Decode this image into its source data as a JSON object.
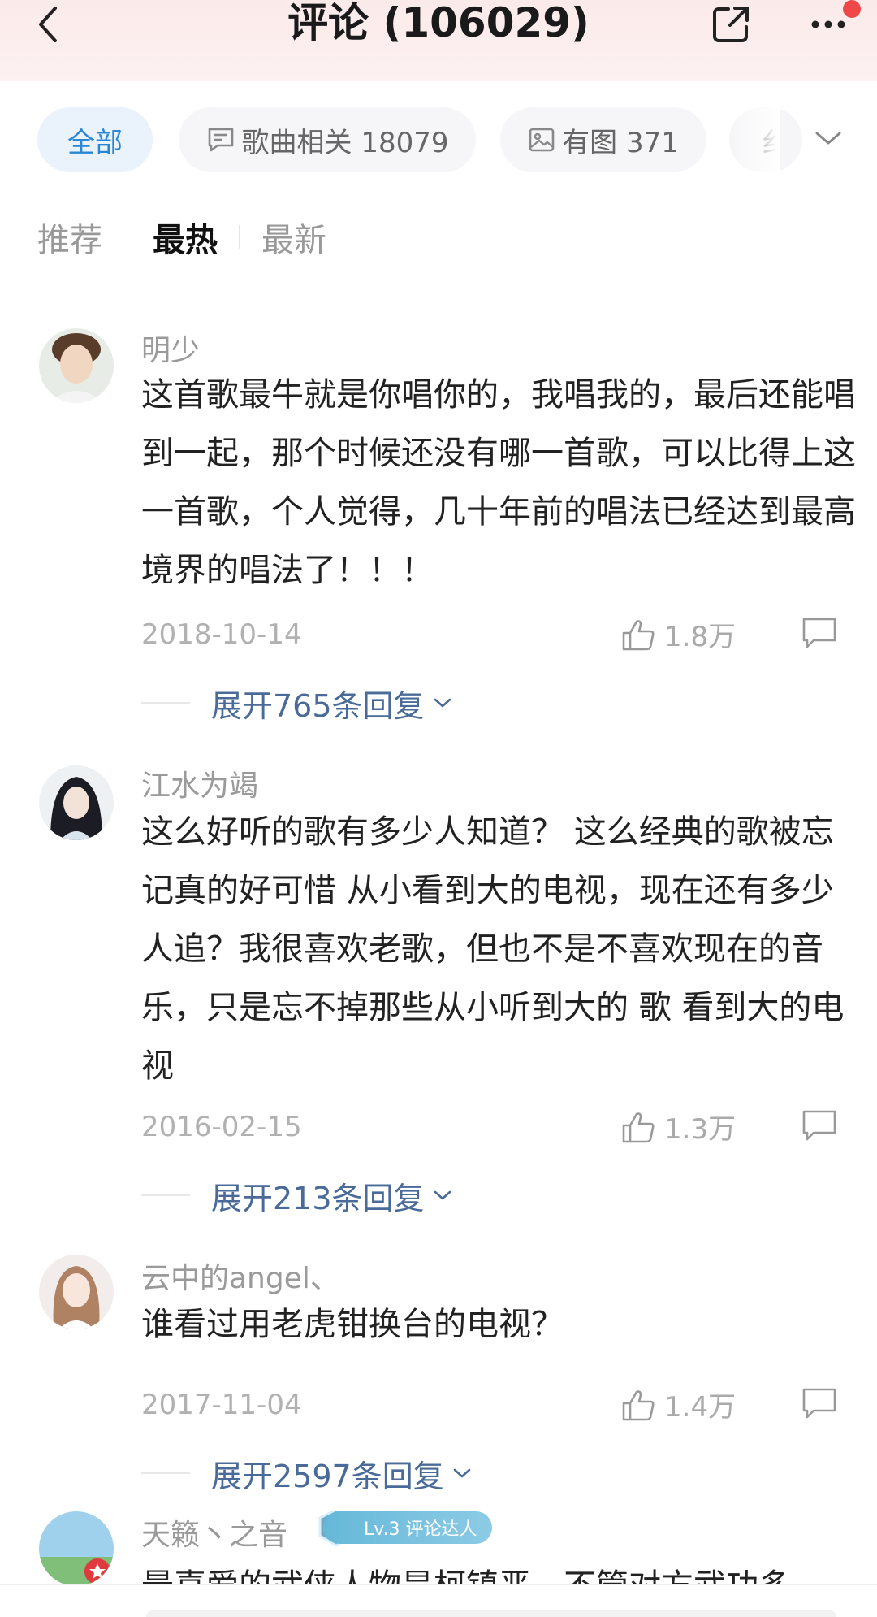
{
  "header": {
    "title": "评论 (106029)",
    "back_icon": "chevron-left-icon",
    "share_icon": "share-external-icon",
    "more_icon": "more-dots-icon"
  },
  "chips": [
    {
      "label": "全部",
      "active": true
    },
    {
      "label": "歌曲相关 18079",
      "icon": "comment-icon"
    },
    {
      "label": "有图 371",
      "icon": "image-icon"
    },
    {
      "label": "纟"
    }
  ],
  "sort_tabs": [
    {
      "label": "推荐"
    },
    {
      "label": "最热",
      "active": true
    },
    {
      "label": "最新"
    }
  ],
  "comments": [
    {
      "username": "明少",
      "content": "这首歌最牛就是你唱你的，我唱我的，最后还能唱到一起，那个时候还没有哪一首歌，可以比得上这一首歌，个人觉得，几十年前的唱法已经达到最高境界的唱法了！！！",
      "date": "2018-10-14",
      "likes": "1.8万",
      "replies": "展开765条回复"
    },
    {
      "username": "江水为竭",
      "content": "这么好听的歌有多少人知道？ 这么经典的歌被忘记真的好可惜 从小看到大的电视，现在还有多少人追？我很喜欢老歌，但也不是不喜欢现在的音乐，只是忘不掉那些从小听到大的 歌 看到大的电视",
      "date": "2016-02-15",
      "likes": "1.3万",
      "replies": "展开213条回复"
    },
    {
      "username": "云中的angel、",
      "content": "谁看过用老虎钳换台的电视？",
      "date": "2017-11-04",
      "likes": "1.4万",
      "replies": "展开2597条回复"
    },
    {
      "username": "天籁丶之音",
      "badge": "Lv.3 评论达人",
      "content": "最喜爱的武侠人物是柯镇恶，不管对方武功多"
    }
  ],
  "colors": {
    "accent": "#2b86d4",
    "link": "#4a6b9a",
    "header_bg": "#fbeaea",
    "notify": "#f04848"
  }
}
